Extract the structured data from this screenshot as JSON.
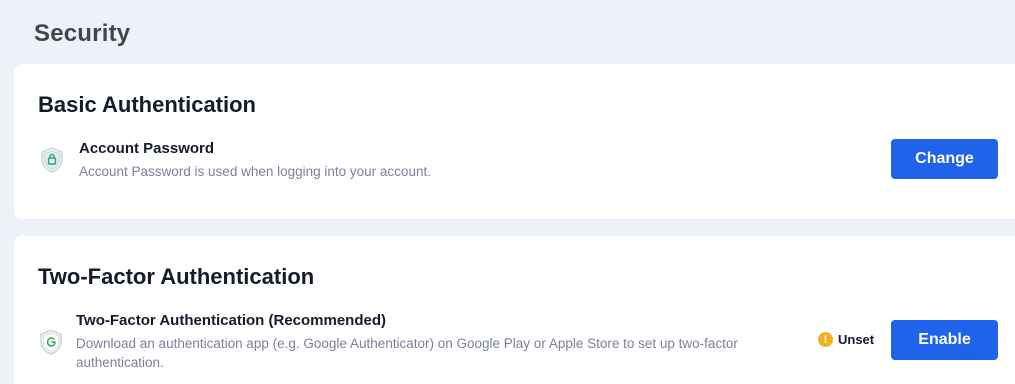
{
  "page": {
    "title": "Security"
  },
  "basic_auth": {
    "title": "Basic Authentication",
    "item": {
      "name": "Account Password",
      "description": "Account Password is used when logging into your account.",
      "icon": "shield-lock-icon",
      "button_label": "Change"
    }
  },
  "two_factor": {
    "title": "Two-Factor Authentication",
    "item": {
      "name": "Two-Factor Authentication (Recommended)",
      "description": "Download an authentication app (e.g. Google Authenticator) on Google Play or Apple Store to set up two-factor authentication.",
      "icon": "shield-google-icon",
      "status_icon_glyph": "!",
      "status_label": "Unset",
      "button_label": "Enable"
    }
  },
  "colors": {
    "primary": "#1e63ea",
    "warning": "#f2b01e",
    "background": "#eef1f7"
  }
}
